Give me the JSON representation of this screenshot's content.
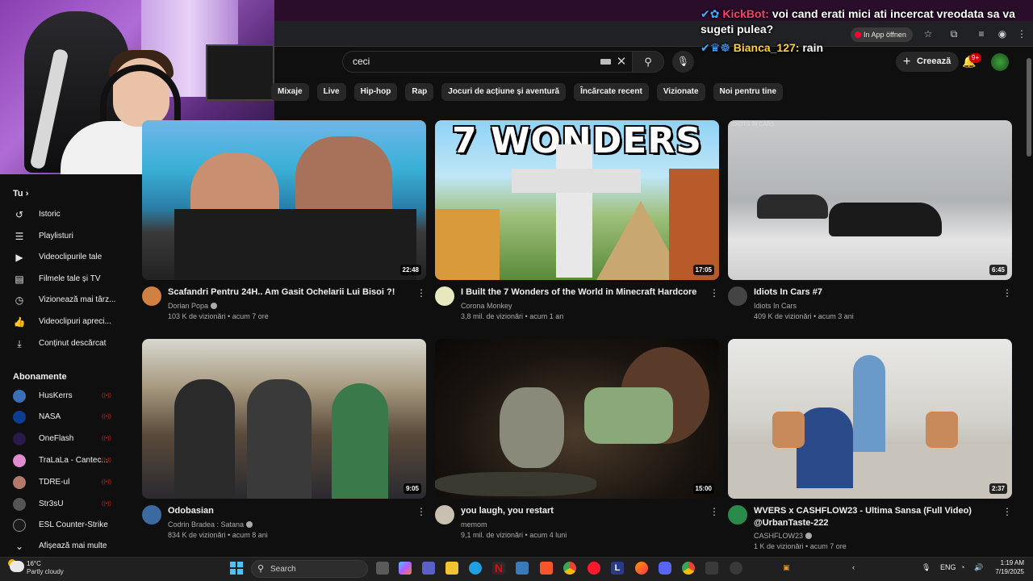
{
  "chat": {
    "lines": [
      {
        "badge": "✔✿",
        "user": "KickBot:",
        "text": "voi cand erati mici ati incercat vreodata sa va sugeti pulea?"
      },
      {
        "badge": "✔♛☸",
        "user": "Bianca_127:",
        "text": "rain"
      }
    ]
  },
  "browser": {
    "inapp_label": "In App öffnen"
  },
  "header": {
    "search_value": "ceci",
    "create_label": "Creează",
    "notif_count": "9+"
  },
  "chips": [
    "Mixaje",
    "Live",
    "Hip-hop",
    "Rap",
    "Jocuri de acțiune și aventură",
    "Încărcate recent",
    "Vizionate",
    "Noi pentru tine"
  ],
  "sidebar": {
    "you_heading": "Tu",
    "you_items": [
      "Istoric",
      "Playlisturi",
      "Videoclipurile tale",
      "Filmele tale și TV",
      "Vizionează mai târz...",
      "Videoclipuri apreci...",
      "Conținut descărcat"
    ],
    "subs_heading": "Abonamente",
    "subs": [
      "HusKerrs",
      "NASA",
      "OneFlash",
      "TraLaLa - Cantec...",
      "TDRE-ul",
      "Str3sU",
      "ESL Counter-Strike"
    ],
    "show_more": "Afișează mai multe"
  },
  "videos": [
    {
      "title": "Scafandri Pentru 24H.. Am Gasit Ochelarii Lui Bisoi ?!",
      "channel": "Dorian Popa",
      "views": "103 K de vizionări",
      "age": "acum 7 ore",
      "duration": "22:48",
      "verified": true
    },
    {
      "title": "I Built the 7 Wonders of the World in Minecraft Hardcore",
      "channel": "Corona Monkey",
      "views": "3,8 mil. de vizionări",
      "age": "acum 1 an",
      "duration": "17:05",
      "verified": false,
      "thumb_text": "7 WONDERS"
    },
    {
      "title": "Idiots In Cars #7",
      "channel": "Idiots In Cars",
      "views": "409 K de vizionări",
      "age": "acum 3 ani",
      "duration": "6:45",
      "verified": false,
      "thumb_tag": "IDIOTS IN CARS"
    },
    {
      "title": "Odobasian",
      "channel": "Codrin Bradea : Satana",
      "views": "834 K de vizionări",
      "age": "acum 8 ani",
      "duration": "9:05",
      "verified": true
    },
    {
      "title": "you laugh, you restart",
      "channel": "memom",
      "views": "9,1 mil. de vizionări",
      "age": "acum 4 luni",
      "duration": "15:00",
      "verified": false
    },
    {
      "title": "WVERS x CASHFLOW23 - Ultima Sansa (Full Video) @UrbanTaste-222",
      "channel": "CASHFLOW23",
      "views": "1 K de vizionări",
      "age": "acum 7 ore",
      "duration": "2:37",
      "verified": true
    }
  ],
  "taskbar": {
    "temp": "16°C",
    "weather": "Partly cloudy",
    "search_label": "Search",
    "lang": "ENG",
    "time": "1:19 AM",
    "date": "7/19/2025"
  },
  "colors": {
    "bg": "#0f0f0f",
    "accent_red": "#ff0033",
    "chip_bg": "#272727",
    "text_secondary": "#aaaaaa"
  }
}
